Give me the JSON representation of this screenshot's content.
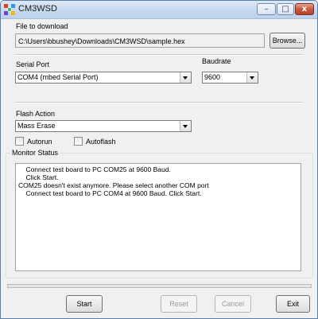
{
  "window": {
    "title": "CM3WSD",
    "minimize_glyph": "–",
    "maximize_glyph": "□",
    "close_glyph": "x"
  },
  "file": {
    "label": "File to download",
    "path": "C:\\Users\\bbushey\\Downloads\\CM3WSD\\sample.hex",
    "browse_label": "Browse..."
  },
  "serial": {
    "port_label": "Serial Port",
    "port_value": "COM4 (mbed Serial Port)",
    "baud_label": "Baudrate",
    "baud_value": "9600"
  },
  "flash": {
    "label": "Flash Action",
    "value": "Mass Erase",
    "autorun_label": "Autorun",
    "autoflash_label": "Autoflash"
  },
  "monitor": {
    "title": "Monitor Status",
    "lines": [
      "    Connect test board to PC COM25 at 9600 Baud.",
      "    Click Start.",
      "COM25 doesn't exist anymore. Please select another COM port",
      "    Connect test board to PC COM4 at 9600 Baud. Click Start."
    ]
  },
  "buttons": {
    "start": "Start",
    "reset": "Reset",
    "cancel": "Cancel",
    "exit": "Exit"
  },
  "colors": {
    "titlebar": "#c5d8ee",
    "window_bg": "#f0f0f0",
    "close_button": "#c75a3e"
  }
}
